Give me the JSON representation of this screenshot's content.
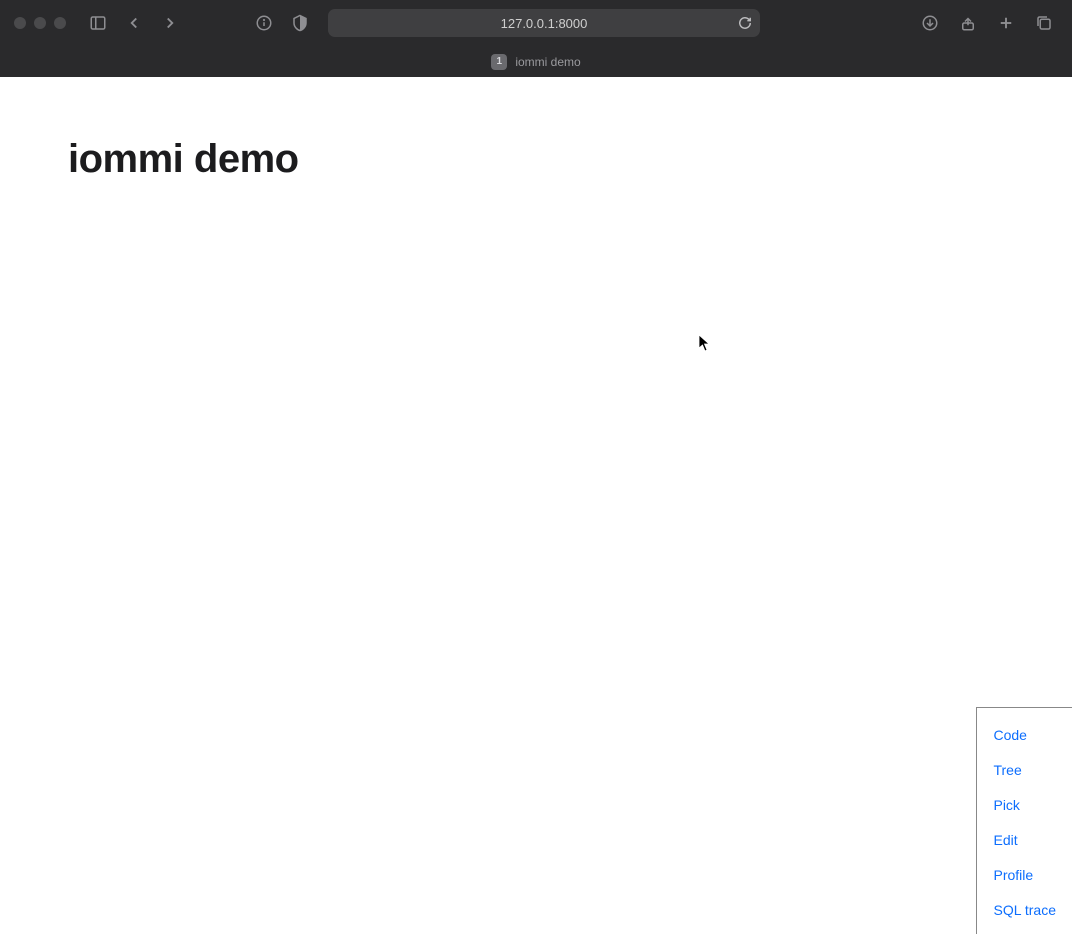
{
  "browser": {
    "address": "127.0.0.1:8000",
    "tab": {
      "badge": "1",
      "title": "iommi demo"
    }
  },
  "page": {
    "heading": "iommi demo"
  },
  "debug_panel": {
    "items": [
      "Code",
      "Tree",
      "Pick",
      "Edit",
      "Profile",
      "SQL trace"
    ]
  }
}
